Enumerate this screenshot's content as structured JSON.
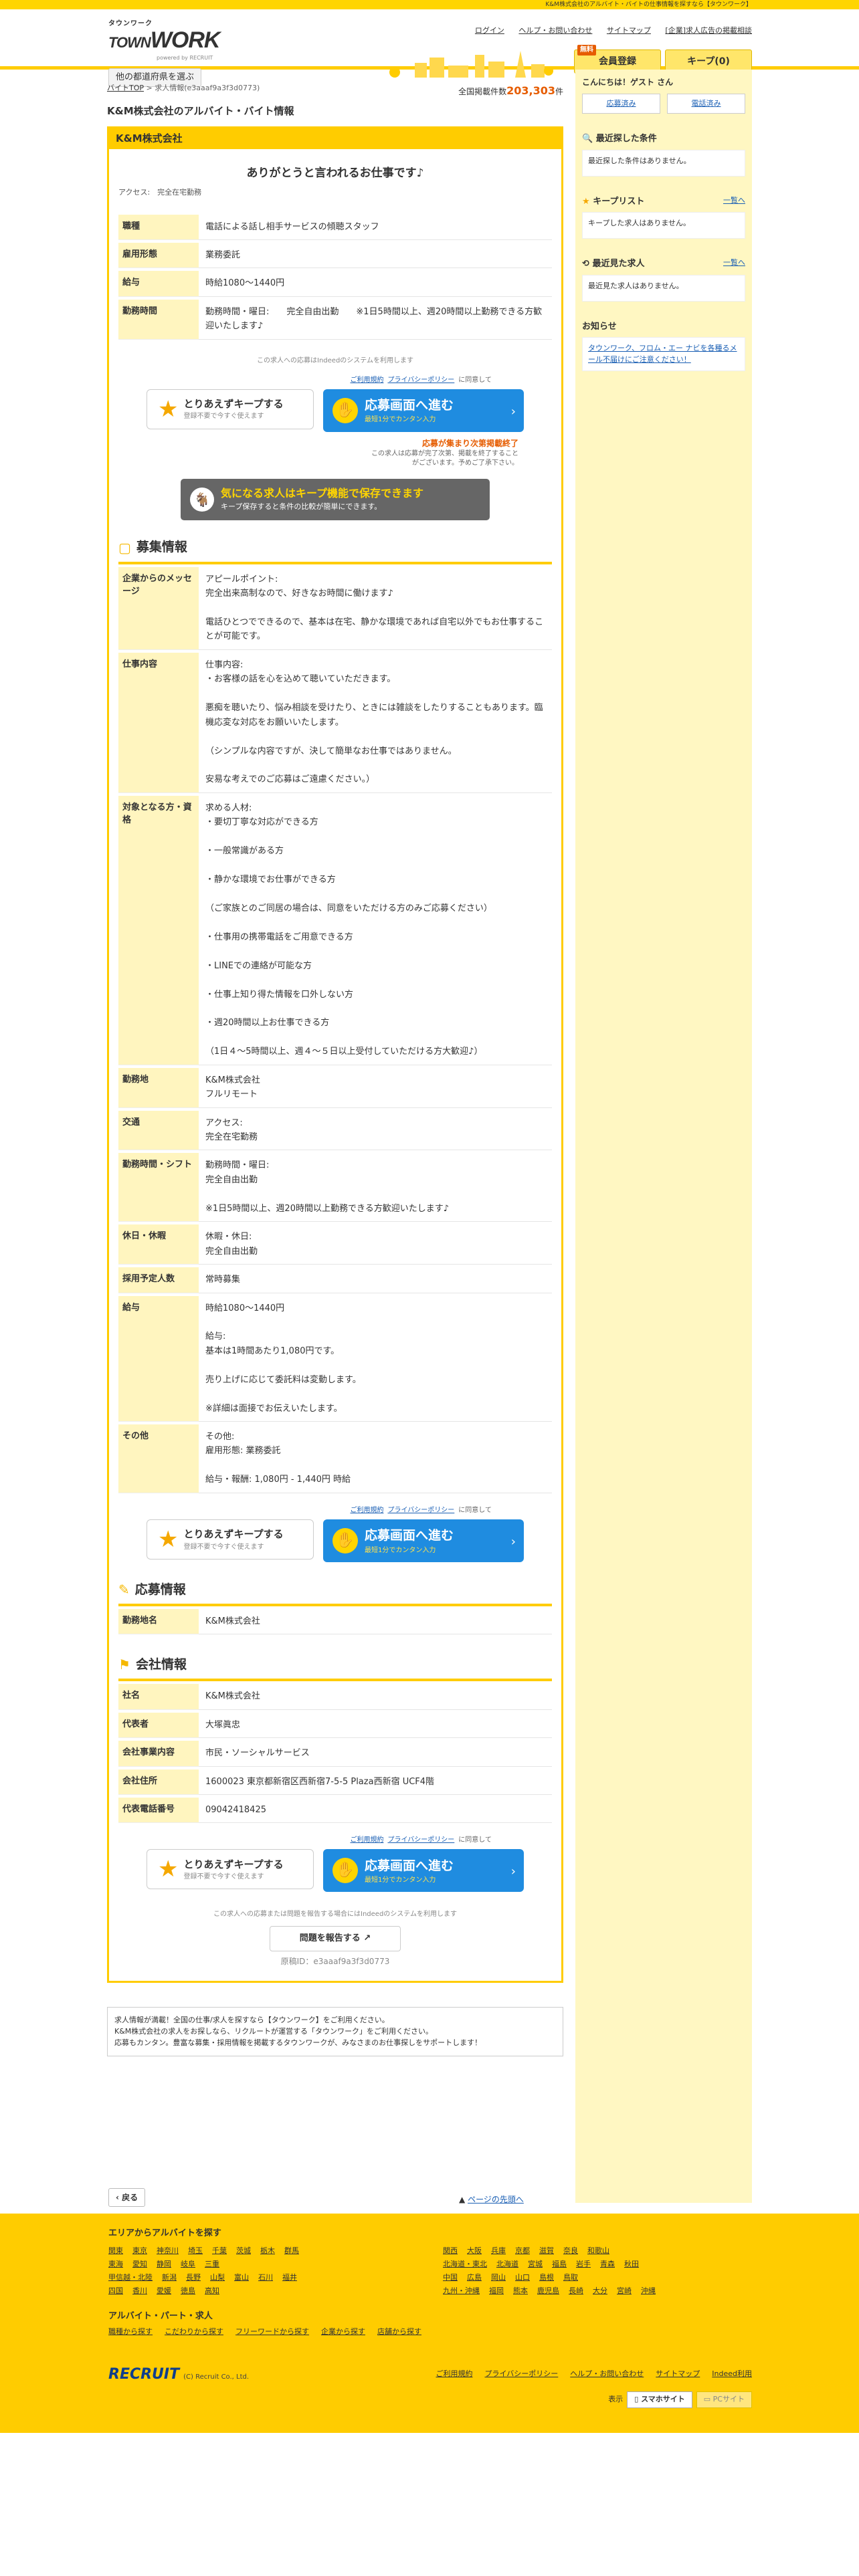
{
  "topbar": "K&M株式会社のアルバイト・バイトの仕事情報を探すなら【タウンワーク】",
  "header": {
    "logo_small": "タウンワーク",
    "logo_big": "TOWN",
    "logo_big2": "WORK",
    "logo_sub": "powered by RECRUIT",
    "pref_btn": "他の都道府県を選ぶ",
    "links": [
      "ログイン",
      "ヘルプ・お問い合わせ",
      "サイトマップ",
      "[企業]求人広告の掲載相談"
    ],
    "free": "無料",
    "register": "会員登録",
    "keep": "キープ(0)"
  },
  "crumb": {
    "top": "バイトTOP",
    "sep": " > ",
    "current": "求人情報(e3aaaf9a3f3d0773)"
  },
  "count": {
    "label": "全国掲載件数",
    "value": "203,303",
    "unit": "件"
  },
  "title": "K&M株式会社のアルバイト・バイト情報",
  "company": "K&M株式会社",
  "catch": "ありがとうと言われるお仕事です♪",
  "access": "アクセス:　完全在宅勤務",
  "summary": [
    {
      "k": "職種",
      "v": "電話による話し相手サービスの傾聴スタッフ"
    },
    {
      "k": "雇用形態",
      "v": "業務委託"
    },
    {
      "k": "給与",
      "v": "時給1080〜1440円"
    },
    {
      "k": "勤務時間",
      "v": "勤務時間・曜日:　　完全自由出勤　　※1日5時間以上、週20時間以上勤務できる方歓迎いたします♪"
    }
  ],
  "indeed_note": "この求人への応募はIndeedのシステムを利用します",
  "terms": {
    "a": "ご利用規約",
    "b": "プライバシーポリシー",
    "c": "に同意して"
  },
  "keep_btn": {
    "t": "とりあえずキープする",
    "s": "登録不要で今すぐ使えます"
  },
  "apply_btn": {
    "t": "応募画面へ進む",
    "s": "最短1分でカンタン入力"
  },
  "deadline": "応募が集まり次第掲載終了",
  "deadline_sub": "この求人は応募が完了次第、掲載を終了することがございます。予めご了承下さい。",
  "banner": {
    "t": "気になる求人はキープ機能で保存できます",
    "s": "キープ保存すると条件の比較が簡単にできます。"
  },
  "sec1": "募集情報",
  "detail": [
    {
      "k": "企業からのメッセージ",
      "v": "アピールポイント:\n完全出来高制なので、好きなお時間に働けます♪\n\n電話ひとつでできるので、基本は在宅、静かな環境であれば自宅以外でもお仕事することが可能です。"
    },
    {
      "k": "仕事内容",
      "v": "仕事内容:\n・お客様の話を心を込めて聴いていただきます。\n\n悪痴を聴いたり、悩み相談を受けたり、ときには雑談をしたりすることもあります。臨機応変な対応をお願いいたします。\n\n（シンプルな内容ですが、決して簡単なお仕事ではありません。\n\n安易な考えでのご応募はご遠慮ください。）"
    },
    {
      "k": "対象となる方・資格",
      "v": "求める人材:\n・要切丁寧な対応ができる方\n\n・一般常識がある方\n\n・静かな環境でお仕事ができる方\n\n（ご家族とのご同居の場合は、同意をいただける方のみご応募ください）\n\n・仕事用の携帯電話をご用意できる方\n\n・LINEでの連絡が可能な方\n\n・仕事上知り得た情報を口外しない方\n\n・週20時間以上お仕事できる方\n\n（1日４〜5時間以上、週４〜５日以上受付していただける方大歓迎♪）"
    },
    {
      "k": "勤務地",
      "v": "K&M株式会社\nフルリモート"
    },
    {
      "k": "交通",
      "v": "アクセス:\n完全在宅勤務"
    },
    {
      "k": "勤務時間・シフト",
      "v": "勤務時間・曜日:\n完全自由出勤\n\n※1日5時間以上、週20時間以上勤務できる方歓迎いたします♪"
    },
    {
      "k": "休日・休暇",
      "v": "休暇・休日:\n完全自由出勤"
    },
    {
      "k": "採用予定人数",
      "v": "常時募集"
    },
    {
      "k": "給与",
      "v": "時給1080〜1440円\n\n給与:\n基本は1時間あたり1,080円です。\n\n売り上げに応じて委託料は変動します。\n\n※詳細は面接でお伝えいたします。"
    },
    {
      "k": "その他",
      "v": "その他:\n雇用形態: 業務委託\n\n給与・報酬: 1,080円 - 1,440円 時給"
    }
  ],
  "sec2": "応募情報",
  "apply_info": [
    {
      "k": "勤務地名",
      "v": "K&M株式会社"
    }
  ],
  "sec3": "会社情報",
  "company_info": [
    {
      "k": "社名",
      "v": "K&M株式会社"
    },
    {
      "k": "代表者",
      "v": "大塚眞忠"
    },
    {
      "k": "会社事業内容",
      "v": "市民・ソーシャルサービス"
    },
    {
      "k": "会社住所",
      "v": "1600023 東京都新宿区西新宿7-5-5 Plaza西新宿 UCF4階"
    },
    {
      "k": "代表電話番号",
      "v": "09042418425"
    }
  ],
  "report_note": "この求人への応募または問題を報告する場合にはIndeedのシステムを利用します",
  "report": "問題を報告する",
  "origid": "原稿ID：e3aaaf9a3f3d0773",
  "about": "求人情報が満載！全国の仕事/求人を探すなら【タウンワーク】をご利用ください。\nK&M株式会社の求人をお探しなら、リクルートが運営する「タウンワーク」をご利用ください。\n応募もカンタン。豊富な募集・採用情報を掲載するタウンワークが、みなさまのお仕事探しをサポートします！",
  "side": {
    "greet": "こんにちは！ゲスト さん",
    "btn1": "応募済み",
    "btn2": "電話済み",
    "recent_cond": "最近探した条件",
    "recent_cond_empty": "最近探した条件はありません。",
    "keeplist": "キープリスト",
    "keeplist_link": "一覧へ",
    "keeplist_empty": "キープした求人はありません。",
    "recent_seen": "最近見た求人",
    "recent_seen_link": "一覧へ",
    "recent_seen_empty": "最近見た求人はありません。",
    "news": "お知らせ",
    "news_text": "タウンワーク、フロム・エー ナビを各種るメール不届けにご注意ください！"
  },
  "back": "戻る",
  "pagetop": "ページの先頭へ",
  "footer": {
    "area_title": "エリアからアルバイトを探す",
    "areas_left": [
      [
        "関東",
        "東京",
        "神奈川",
        "埼玉",
        "千葉",
        "茨城",
        "栃木",
        "群馬"
      ],
      [
        "東海",
        "愛知",
        "静岡",
        "岐阜",
        "三重"
      ],
      [
        "甲信越・北陸",
        "新潟",
        "長野",
        "山梨",
        "富山",
        "石川",
        "福井"
      ],
      [
        "四国",
        "香川",
        "愛媛",
        "徳島",
        "高知"
      ]
    ],
    "areas_right": [
      [
        "関西",
        "大阪",
        "兵庫",
        "京都",
        "滋賀",
        "奈良",
        "和歌山"
      ],
      [
        "北海道・東北",
        "北海道",
        "宮城",
        "福島",
        "岩手",
        "青森",
        "秋田"
      ],
      [
        "中国",
        "広島",
        "岡山",
        "山口",
        "島根",
        "鳥取"
      ],
      [
        "九州・沖縄",
        "福岡",
        "熊本",
        "鹿児島",
        "長崎",
        "大分",
        "宮崎",
        "沖縄"
      ]
    ],
    "search_title": "アルバイト・パート・求人",
    "searches": [
      "職種から探す",
      "こだわりから探す",
      "フリーワードから探す",
      "企業から探す",
      "店舗から探す"
    ],
    "recruit": "RECRUIT",
    "recruit_sub": "(C) Recruit Co., Ltd.",
    "links": [
      "ご利用規約",
      "プライバシーポリシー",
      "ヘルプ・お問い合わせ",
      "サイトマップ",
      "Indeed利用"
    ],
    "display": "表示",
    "sp": "スマホサイト",
    "pc": "PCサイト"
  }
}
